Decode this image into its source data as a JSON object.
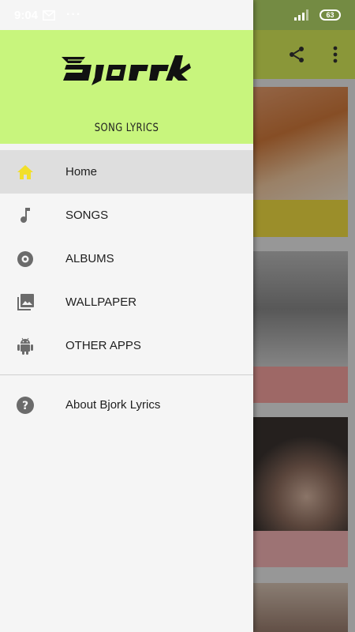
{
  "status_bar": {
    "time": "9:04",
    "notification_icons": [
      "gmail-icon"
    ],
    "overflow": "···",
    "battery": "63"
  },
  "drawer": {
    "header": {
      "logo_text": "bjork",
      "subtitle": "SONG LYRICS",
      "background": "#c8f57d"
    },
    "menu": [
      {
        "label": "Home",
        "icon": "home-icon",
        "active": true
      },
      {
        "label": "SONGS",
        "icon": "music-note-icon",
        "active": false
      },
      {
        "label": "ALBUMS",
        "icon": "album-disc-icon",
        "active": false
      },
      {
        "label": "WALLPAPER",
        "icon": "gallery-icon",
        "active": false
      },
      {
        "label": "OTHER APPS",
        "icon": "android-icon",
        "active": false
      }
    ],
    "secondary_menu": [
      {
        "label": "About Bjork Lyrics",
        "icon": "help-icon"
      }
    ]
  },
  "background_app": {
    "toolbar_icons": [
      "share-icon",
      "more-vert-icon"
    ],
    "toolbar_color": "#d8ec5a"
  }
}
